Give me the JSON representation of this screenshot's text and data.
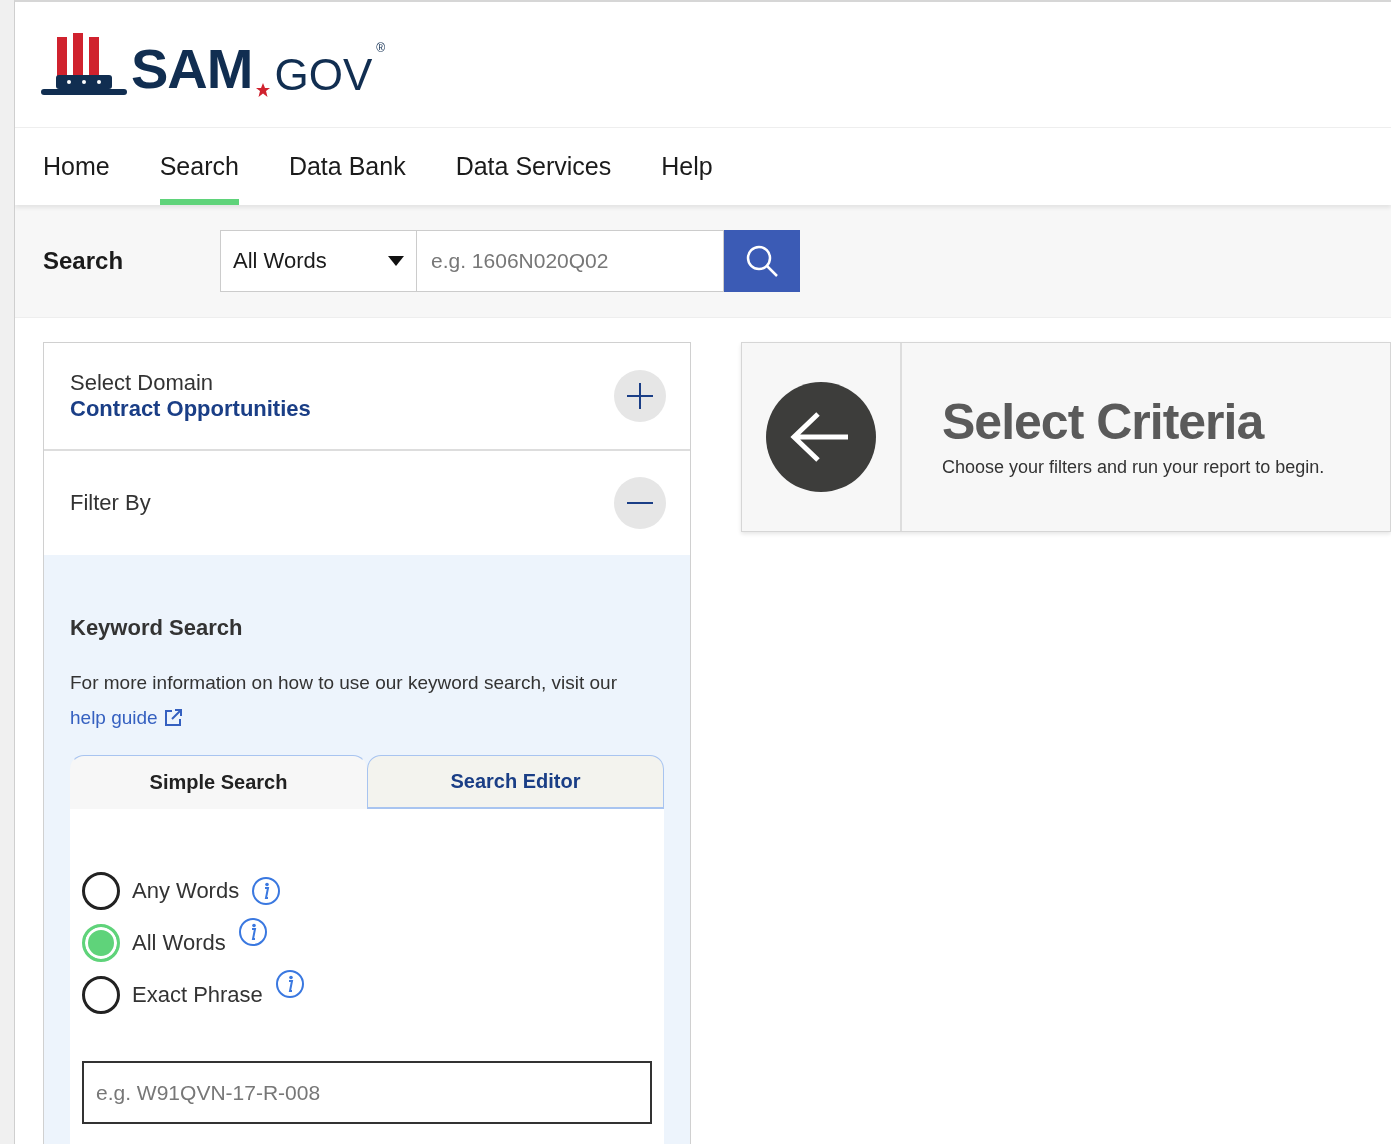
{
  "logo": {
    "primary": "SAM",
    "secondary": "GOV",
    "mark": "®"
  },
  "nav": [
    {
      "label": "Home",
      "selected": false
    },
    {
      "label": "Search",
      "selected": true
    },
    {
      "label": "Data Bank",
      "selected": false
    },
    {
      "label": "Data Services",
      "selected": false
    },
    {
      "label": "Help",
      "selected": false
    }
  ],
  "search_bar": {
    "label": "Search",
    "mode": "All Words",
    "placeholder": "e.g. 1606N020Q02"
  },
  "sidebar": {
    "domain": {
      "title": "Select Domain",
      "value": "Contract Opportunities",
      "expanded": false
    },
    "filter": {
      "title": "Filter By",
      "expanded": true
    },
    "keyword": {
      "title": "Keyword Search",
      "info": "For more information on how to use our keyword search, visit our",
      "link": "help guide",
      "tabs": [
        {
          "label": "Simple Search",
          "selected": true
        },
        {
          "label": "Search Editor",
          "selected": false
        }
      ],
      "options": [
        {
          "label": "Any Words",
          "selected": false
        },
        {
          "label": "All Words",
          "selected": true
        },
        {
          "label": "Exact Phrase",
          "selected": false
        }
      ],
      "placeholder": "e.g. W91QVN-17-R-008"
    }
  },
  "criteria": {
    "title": "Select Criteria",
    "subtitle": "Choose your filters and run your report to begin."
  }
}
